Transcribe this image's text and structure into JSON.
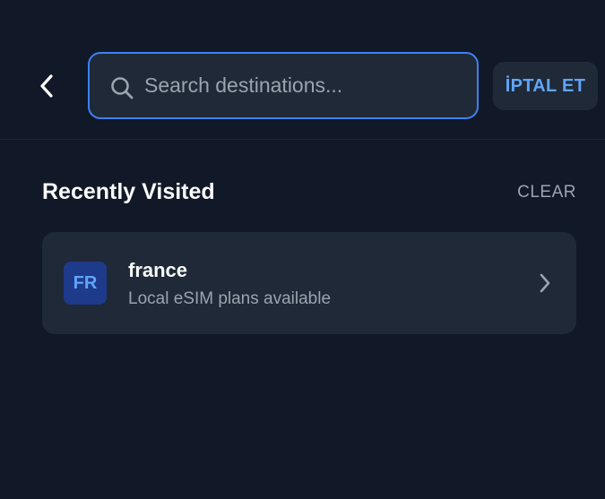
{
  "header": {
    "back_icon": "chevron-left-icon",
    "search": {
      "icon": "search-icon",
      "placeholder": "Search destinations...",
      "value": ""
    },
    "cancel_label": "İPTAL ET"
  },
  "recent": {
    "title": "Recently Visited",
    "clear_label": "CLEAR",
    "items": [
      {
        "code": "FR",
        "name": "france",
        "subtitle": "Local eSIM plans available",
        "icon": "chevron-right-icon"
      }
    ]
  },
  "colors": {
    "background": "#111827",
    "surface": "#1f2937",
    "accent": "#3b82f6",
    "accent_text": "#60a5fa",
    "muted_text": "#9ca3af"
  }
}
